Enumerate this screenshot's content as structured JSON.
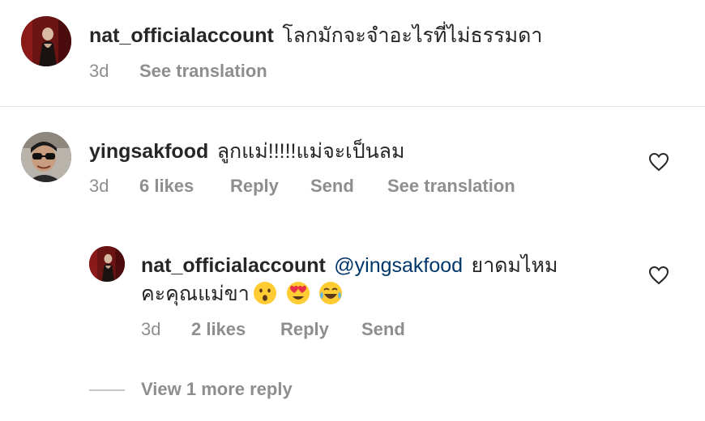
{
  "comments": [
    {
      "username": "nat_officialaccount",
      "text": "โลกมักจะจำอะไรที่ไม่ธรรมดา",
      "time": "3d",
      "see_translation": "See translation"
    },
    {
      "username": "yingsakfood",
      "text": "ลูกแม่!!!!!แม่จะเป็นลม",
      "time": "3d",
      "likes": "6 likes",
      "reply": "Reply",
      "send": "Send",
      "see_translation": "See translation"
    }
  ],
  "reply": {
    "username": "nat_officialaccount",
    "mention": "@yingsakfood",
    "text_line1": "ยาดมไหม",
    "text_line2": "คะคุณแม่ขา",
    "emojis": [
      "hushed-face",
      "heart-eyes",
      "tears-of-joy"
    ],
    "time": "3d",
    "likes": "2 likes",
    "reply": "Reply",
    "send": "Send"
  },
  "view_more": "View 1 more reply",
  "colors": {
    "text": "#262626",
    "secondary": "#8e8e8e",
    "mention": "#00376b",
    "divider": "#e6e6e6"
  }
}
